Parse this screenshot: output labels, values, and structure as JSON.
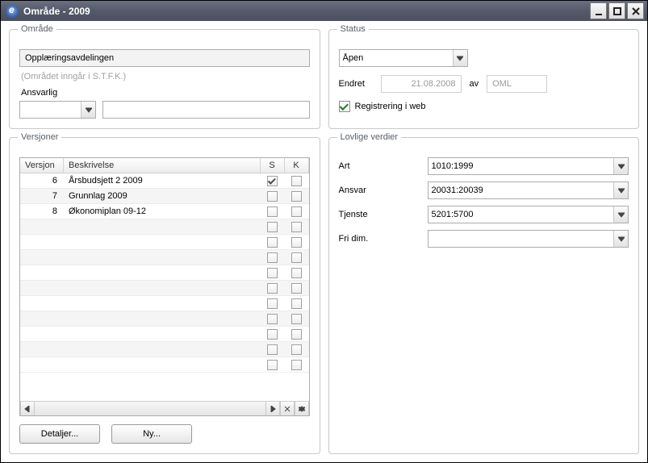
{
  "window": {
    "title": "Område - 2009"
  },
  "omrade": {
    "panel_title": "Område",
    "name": "Opplæringsavdelingen",
    "context": "(Området inngår i S.T.F.K.)",
    "ansvarlig_label": "Ansvarlig",
    "ansvarlig_value": "",
    "ansvarlig_text": ""
  },
  "status": {
    "panel_title": "Status",
    "status_value": "Åpen",
    "endret_label": "Endret",
    "endret_date": "21.08.2008",
    "av_label": "av",
    "user": "OML",
    "reg_web_label": "Registrering i web",
    "reg_web_checked": true
  },
  "versjoner": {
    "panel_title": "Versjoner",
    "headers": {
      "versjon": "Versjon",
      "beskrivelse": "Beskrivelse",
      "s": "S",
      "k": "K"
    },
    "rows": [
      {
        "versjon": "6",
        "beskrivelse": "Årsbudsjett 2 2009",
        "s": true,
        "k": false
      },
      {
        "versjon": "7",
        "beskrivelse": "Grunnlag 2009",
        "s": false,
        "k": false
      },
      {
        "versjon": "8",
        "beskrivelse": "Økonomiplan 09-12",
        "s": false,
        "k": false
      }
    ],
    "details_label": "Detaljer...",
    "new_label": "Ny..."
  },
  "lovlige": {
    "panel_title": "Lovlige verdier",
    "fields": {
      "art": {
        "label": "Art",
        "value": "1010:1999"
      },
      "ansvar": {
        "label": "Ansvar",
        "value": "20031:20039"
      },
      "tjenste": {
        "label": "Tjenste",
        "value": "5201:5700"
      },
      "fridim": {
        "label": "Fri dim.",
        "value": ""
      }
    }
  }
}
